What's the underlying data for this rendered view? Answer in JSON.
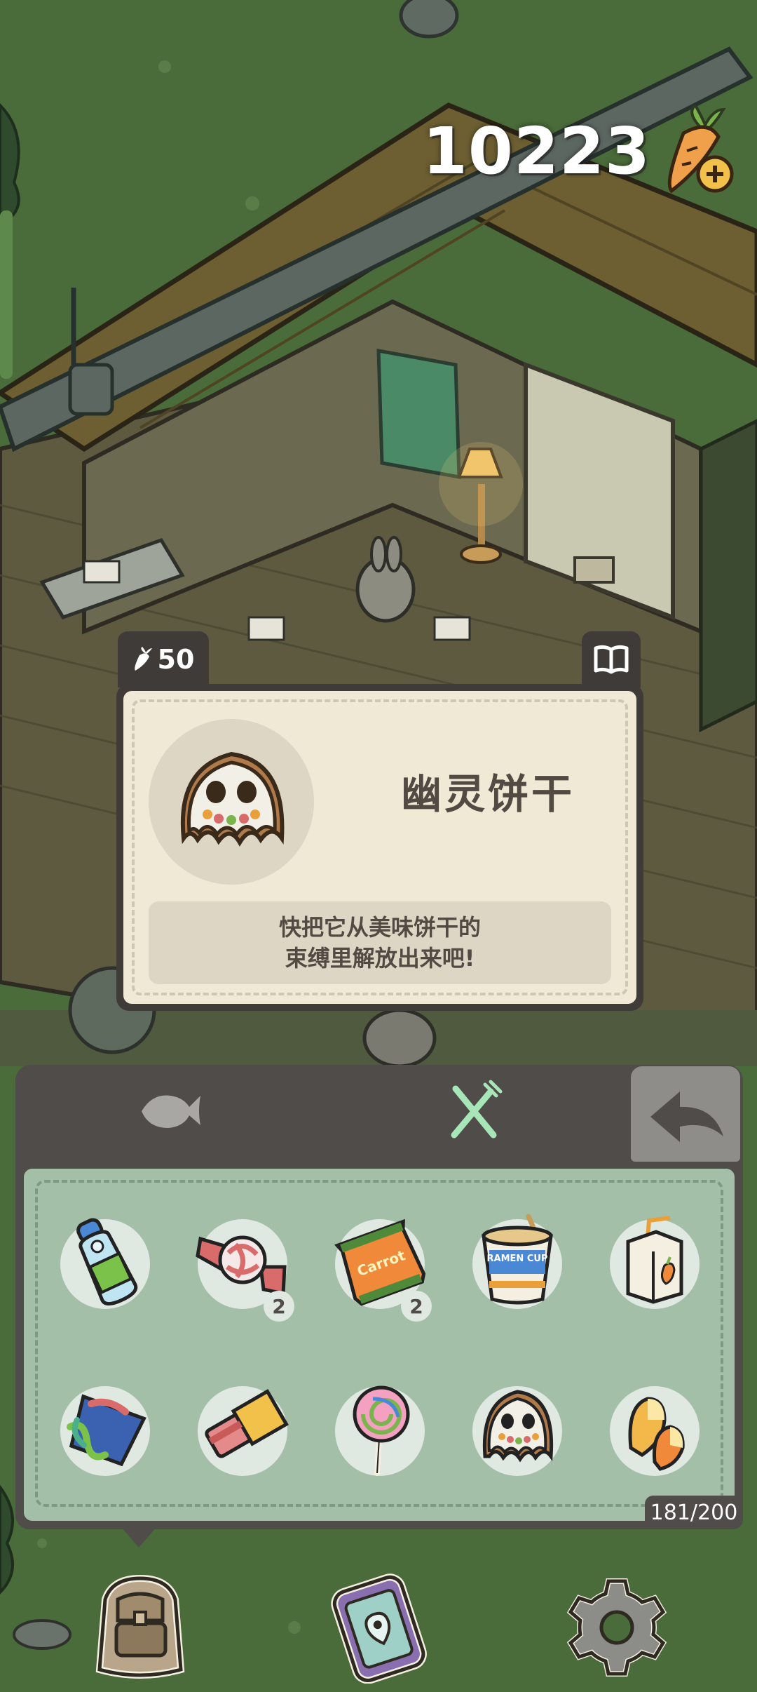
{
  "currency": {
    "value": "10223",
    "icon": "carrot-plus-icon"
  },
  "item_card": {
    "price": "50",
    "price_icon": "carrot-icon",
    "book_icon": "book-icon",
    "name": "幽灵饼干",
    "description": "快把它从美味饼干的\n束缚里解放出来吧!",
    "image_icon": "ghost-cookie-icon"
  },
  "inventory": {
    "tabs": [
      {
        "icon": "fish-icon",
        "active": false
      },
      {
        "icon": "fork-knife-icon",
        "active": true
      }
    ],
    "back_icon": "back-arrow-icon",
    "capacity": "181/200",
    "items": [
      {
        "icon": "ramune-bottle-icon",
        "count": ""
      },
      {
        "icon": "wrapped-candy-icon",
        "count": "2"
      },
      {
        "icon": "carrot-chips-bag-icon",
        "count": "2"
      },
      {
        "icon": "ramen-cup-icon",
        "count": ""
      },
      {
        "icon": "juice-box-icon",
        "count": ""
      },
      {
        "icon": "gummy-worms-icon",
        "count": ""
      },
      {
        "icon": "strawberry-bar-icon",
        "count": ""
      },
      {
        "icon": "lollipop-icon",
        "count": ""
      },
      {
        "icon": "ghost-cookie-icon",
        "count": ""
      },
      {
        "icon": "candy-corn-icon",
        "count": ""
      }
    ],
    "chips_bag_label": "Carrot",
    "ramen_label": "RAMEN CUP"
  },
  "bottom_nav": [
    {
      "icon": "backpack-icon"
    },
    {
      "icon": "phone-map-icon"
    },
    {
      "icon": "settings-gear-icon"
    }
  ],
  "colors": {
    "grass": "#4a6b3a",
    "panel_dark": "#4f4c4a",
    "inventory_green": "#a3bfa8",
    "card_cream": "#f0e9d6",
    "text_brown": "#524b44"
  }
}
